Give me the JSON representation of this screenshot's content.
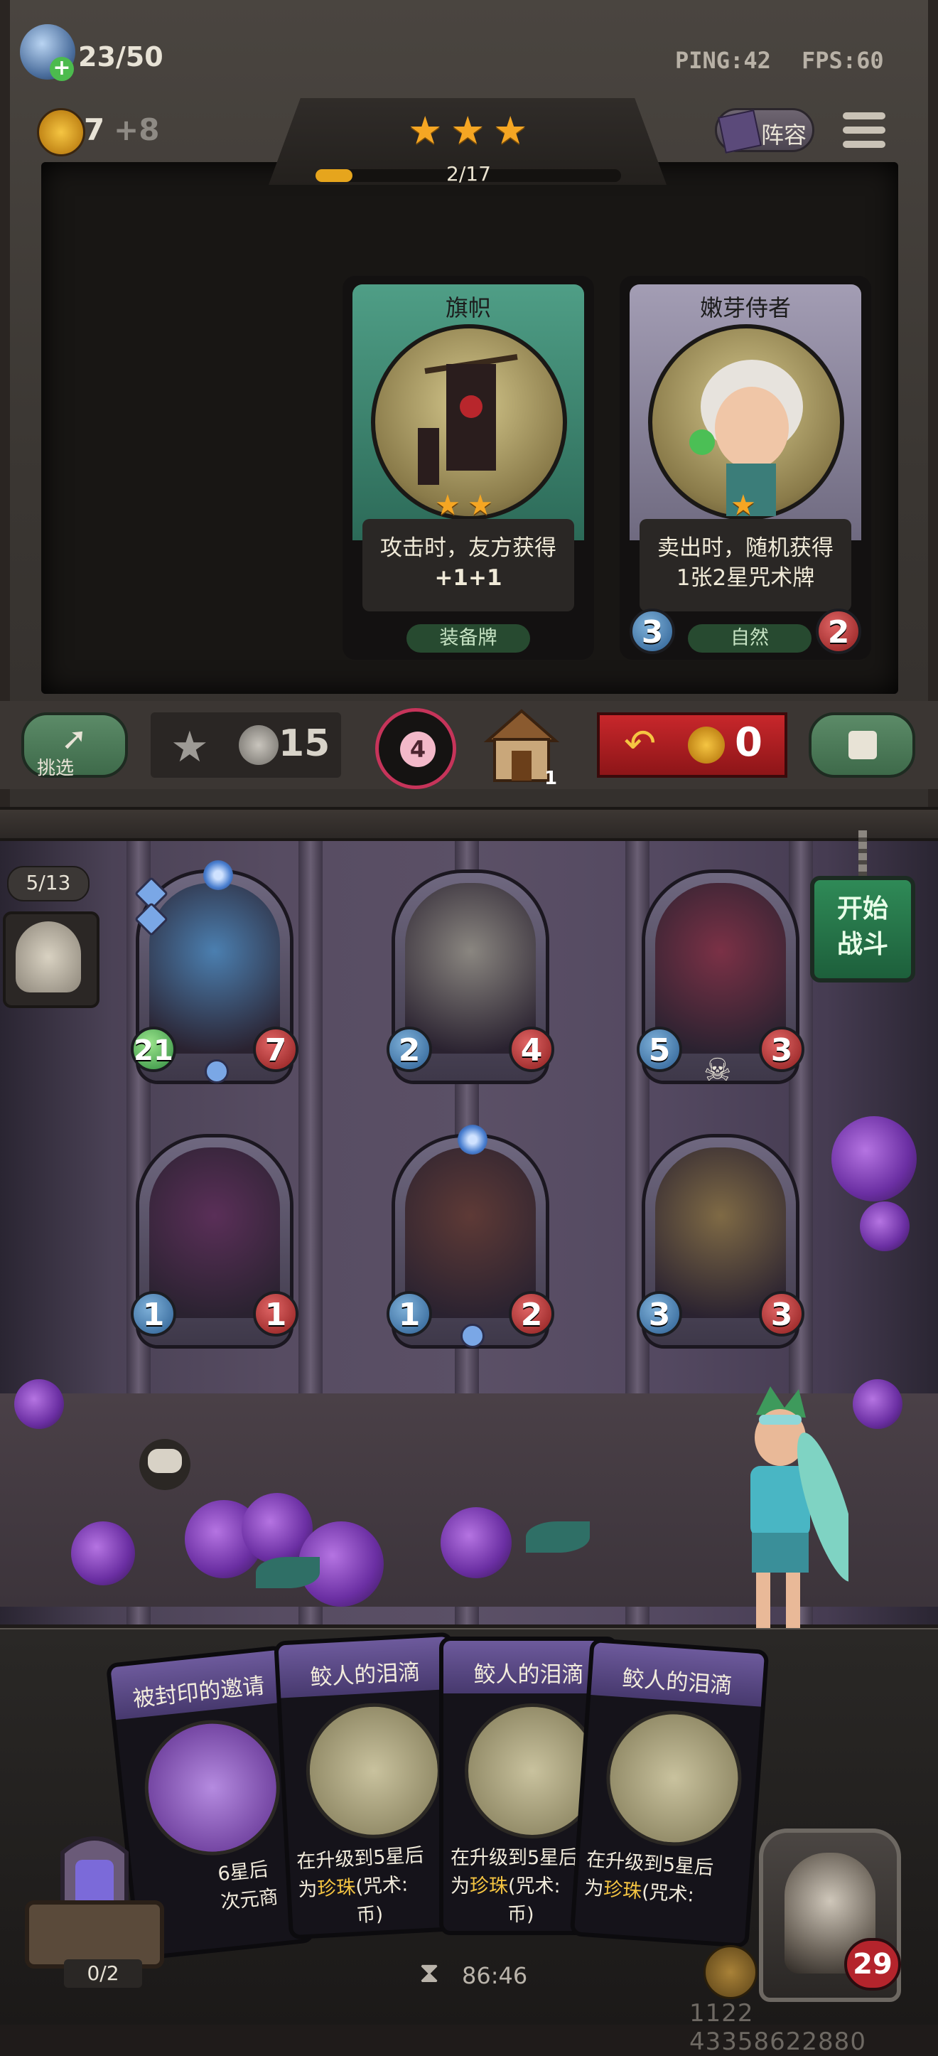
{
  "hud": {
    "xp": "23/50",
    "gold": "7",
    "gold_bonus": "+8",
    "ping": "PING:42",
    "fps": "FPS:60",
    "stars": 3,
    "level_progress": "2/17",
    "level_progress_fraction": 0.12,
    "lineup_label": "阵容",
    "icons": {
      "xp": "potion-icon",
      "gold": "crown-coin-icon",
      "menu": "menu-icon",
      "lineup": "book-icon"
    }
  },
  "shop": {
    "cards": [
      {
        "name": "旗帜",
        "stars": 2,
        "desc_line1": "攻击时，友方获得",
        "desc_line2": "+1+1",
        "type": "装备牌",
        "frame_color": "#3f8a73"
      },
      {
        "name": "嫩芽侍者",
        "stars": 1,
        "desc_line1": "卖出时，随机获得",
        "desc_line2": "1张2星咒术牌",
        "type": "自然",
        "attack": "3",
        "health": "2",
        "frame_color": "#8f8aa0"
      }
    ]
  },
  "actions": {
    "pick_label": "挑选",
    "upgrade_cost": "15",
    "flower_value": "4",
    "house_count": "1",
    "refresh_cost": "0",
    "icons": {
      "pick": "arrow-up-right-icon",
      "upgrade": "star-icon",
      "house": "house-icon",
      "refresh": "undo-arrow-icon",
      "lock": "lock-icon"
    }
  },
  "battle": {
    "round": "5/13",
    "fight_label_1": "开始",
    "fight_label_2": "战斗",
    "board": [
      {
        "name": "dragon",
        "attack": "21",
        "health": "7",
        "attack_buffed": true,
        "art_color": "#4b7fb0"
      },
      {
        "name": "windmill",
        "attack": "2",
        "health": "4",
        "attack_buffed": false,
        "art_color": "#8a8680"
      },
      {
        "name": "red-dragon",
        "attack": "5",
        "health": "3",
        "attack_buffed": false,
        "art_color": "#7b3146"
      },
      {
        "name": "spirit",
        "attack": "1",
        "health": "1",
        "attack_buffed": false,
        "art_color": "#5a2f58"
      },
      {
        "name": "barbarian",
        "attack": "1",
        "health": "2",
        "attack_buffed": false,
        "art_color": "#5e3a36"
      },
      {
        "name": "golem",
        "attack": "3",
        "health": "3",
        "attack_buffed": false,
        "art_color": "#7f6a45"
      }
    ]
  },
  "hand": {
    "cards": [
      {
        "name": "被封印的邀请",
        "line1": "6星后",
        "line2": "次元商",
        "line3": ""
      },
      {
        "name": "鲛人的泪滴",
        "line1": "在升级到5星后",
        "line2_pre": "为",
        "line2_hl": "珍珠",
        "line2_post": "(咒术:",
        "line3": "币)"
      },
      {
        "name": "鲛人的泪滴",
        "line1": "在升级到5星后",
        "line2_pre": "为",
        "line2_hl": "珍珠",
        "line2_post": "(咒术:",
        "line3": "币)"
      },
      {
        "name": "鲛人的泪滴",
        "line1": "在升级到5星后",
        "line2_pre": "为",
        "line2_hl": "珍珠",
        "line2_post": "(咒术:",
        "line3": ""
      }
    ],
    "chest_count": "0/2",
    "timer": "86:46",
    "player_hp": "29",
    "debug_id": "1122 43358622880"
  }
}
